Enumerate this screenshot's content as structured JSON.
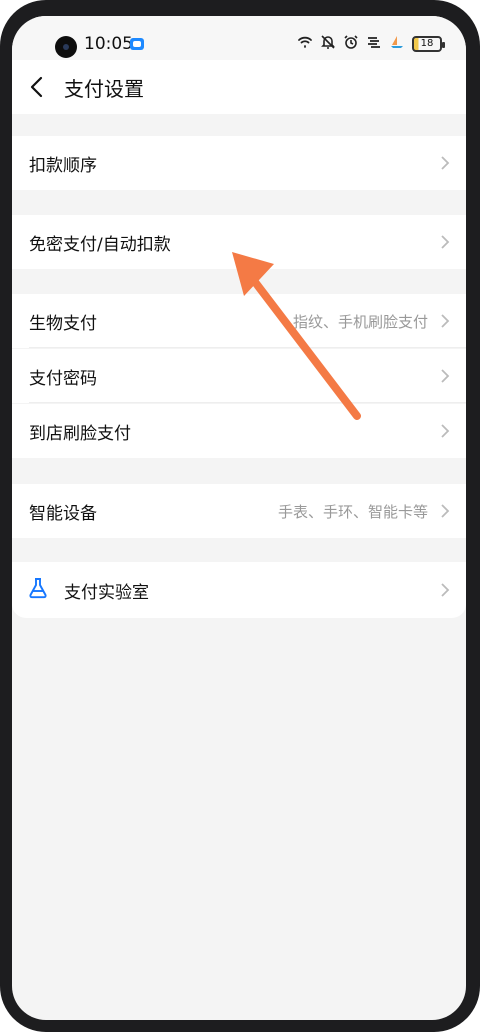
{
  "status_bar": {
    "time": "10:05",
    "battery": "18",
    "icons": [
      "wifi-icon",
      "mute-icon",
      "alarm-icon",
      "signal-icon",
      "boat-icon",
      "battery-icon"
    ]
  },
  "header": {
    "title": "支付设置"
  },
  "rows": {
    "deduct_order": {
      "label": "扣款顺序"
    },
    "auto_pay": {
      "label": "免密支付/自动扣款"
    },
    "bio_pay": {
      "label": "生物支付",
      "value": "指纹、手机刷脸支付"
    },
    "pay_password": {
      "label": "支付密码"
    },
    "store_face_pay": {
      "label": "到店刷脸支付"
    },
    "smart_device": {
      "label": "智能设备",
      "value": "手表、手环、智能卡等"
    },
    "pay_lab": {
      "label": "支付实验室"
    }
  },
  "colors": {
    "accent_arrow": "#f47a45",
    "lab_icon": "#1677ff",
    "background": "#f4f4f4"
  }
}
